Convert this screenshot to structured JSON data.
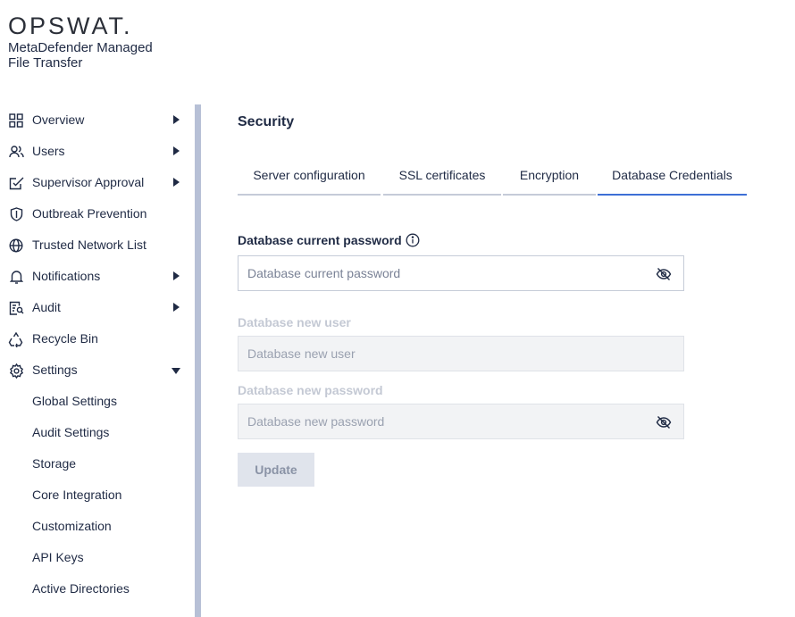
{
  "brand": {
    "logo": "OPSWAT.",
    "product_line1": "MetaDefender Managed",
    "product_line2": "File Transfer"
  },
  "sidebar": {
    "items": [
      {
        "label": "Overview",
        "icon": "grid-icon",
        "expandable": true
      },
      {
        "label": "Users",
        "icon": "users-icon",
        "expandable": true
      },
      {
        "label": "Supervisor Approval",
        "icon": "approval-icon",
        "expandable": true
      },
      {
        "label": "Outbreak Prevention",
        "icon": "shield-icon",
        "expandable": false
      },
      {
        "label": "Trusted Network List",
        "icon": "globe-icon",
        "expandable": false
      },
      {
        "label": "Notifications",
        "icon": "bell-icon",
        "expandable": true
      },
      {
        "label": "Audit",
        "icon": "audit-icon",
        "expandable": true
      },
      {
        "label": "Recycle Bin",
        "icon": "recycle-icon",
        "expandable": false
      },
      {
        "label": "Settings",
        "icon": "gear-icon",
        "expandable": true,
        "expanded": true
      }
    ],
    "settings_children": [
      "Global Settings",
      "Audit Settings",
      "Storage",
      "Core Integration",
      "Customization",
      "API Keys",
      "Active Directories"
    ]
  },
  "main": {
    "title": "Security",
    "tabs": [
      {
        "label": "Server configuration",
        "active": false
      },
      {
        "label": "SSL certificates",
        "active": false
      },
      {
        "label": "Encryption",
        "active": false
      },
      {
        "label": "Database Credentials",
        "active": true
      }
    ],
    "form": {
      "current_password": {
        "label": "Database current password",
        "placeholder": "Database current password",
        "value": ""
      },
      "new_user": {
        "label": "Database new user",
        "placeholder": "Database new user",
        "value": "",
        "disabled": true
      },
      "new_password": {
        "label": "Database new password",
        "placeholder": "Database new password",
        "value": "",
        "disabled": true
      },
      "update_label": "Update"
    }
  },
  "colors": {
    "accent": "#3d6fd6",
    "text": "#1f2a44",
    "disabled_text": "#c4c9d4",
    "scrollbar": "#b7c0d6"
  }
}
